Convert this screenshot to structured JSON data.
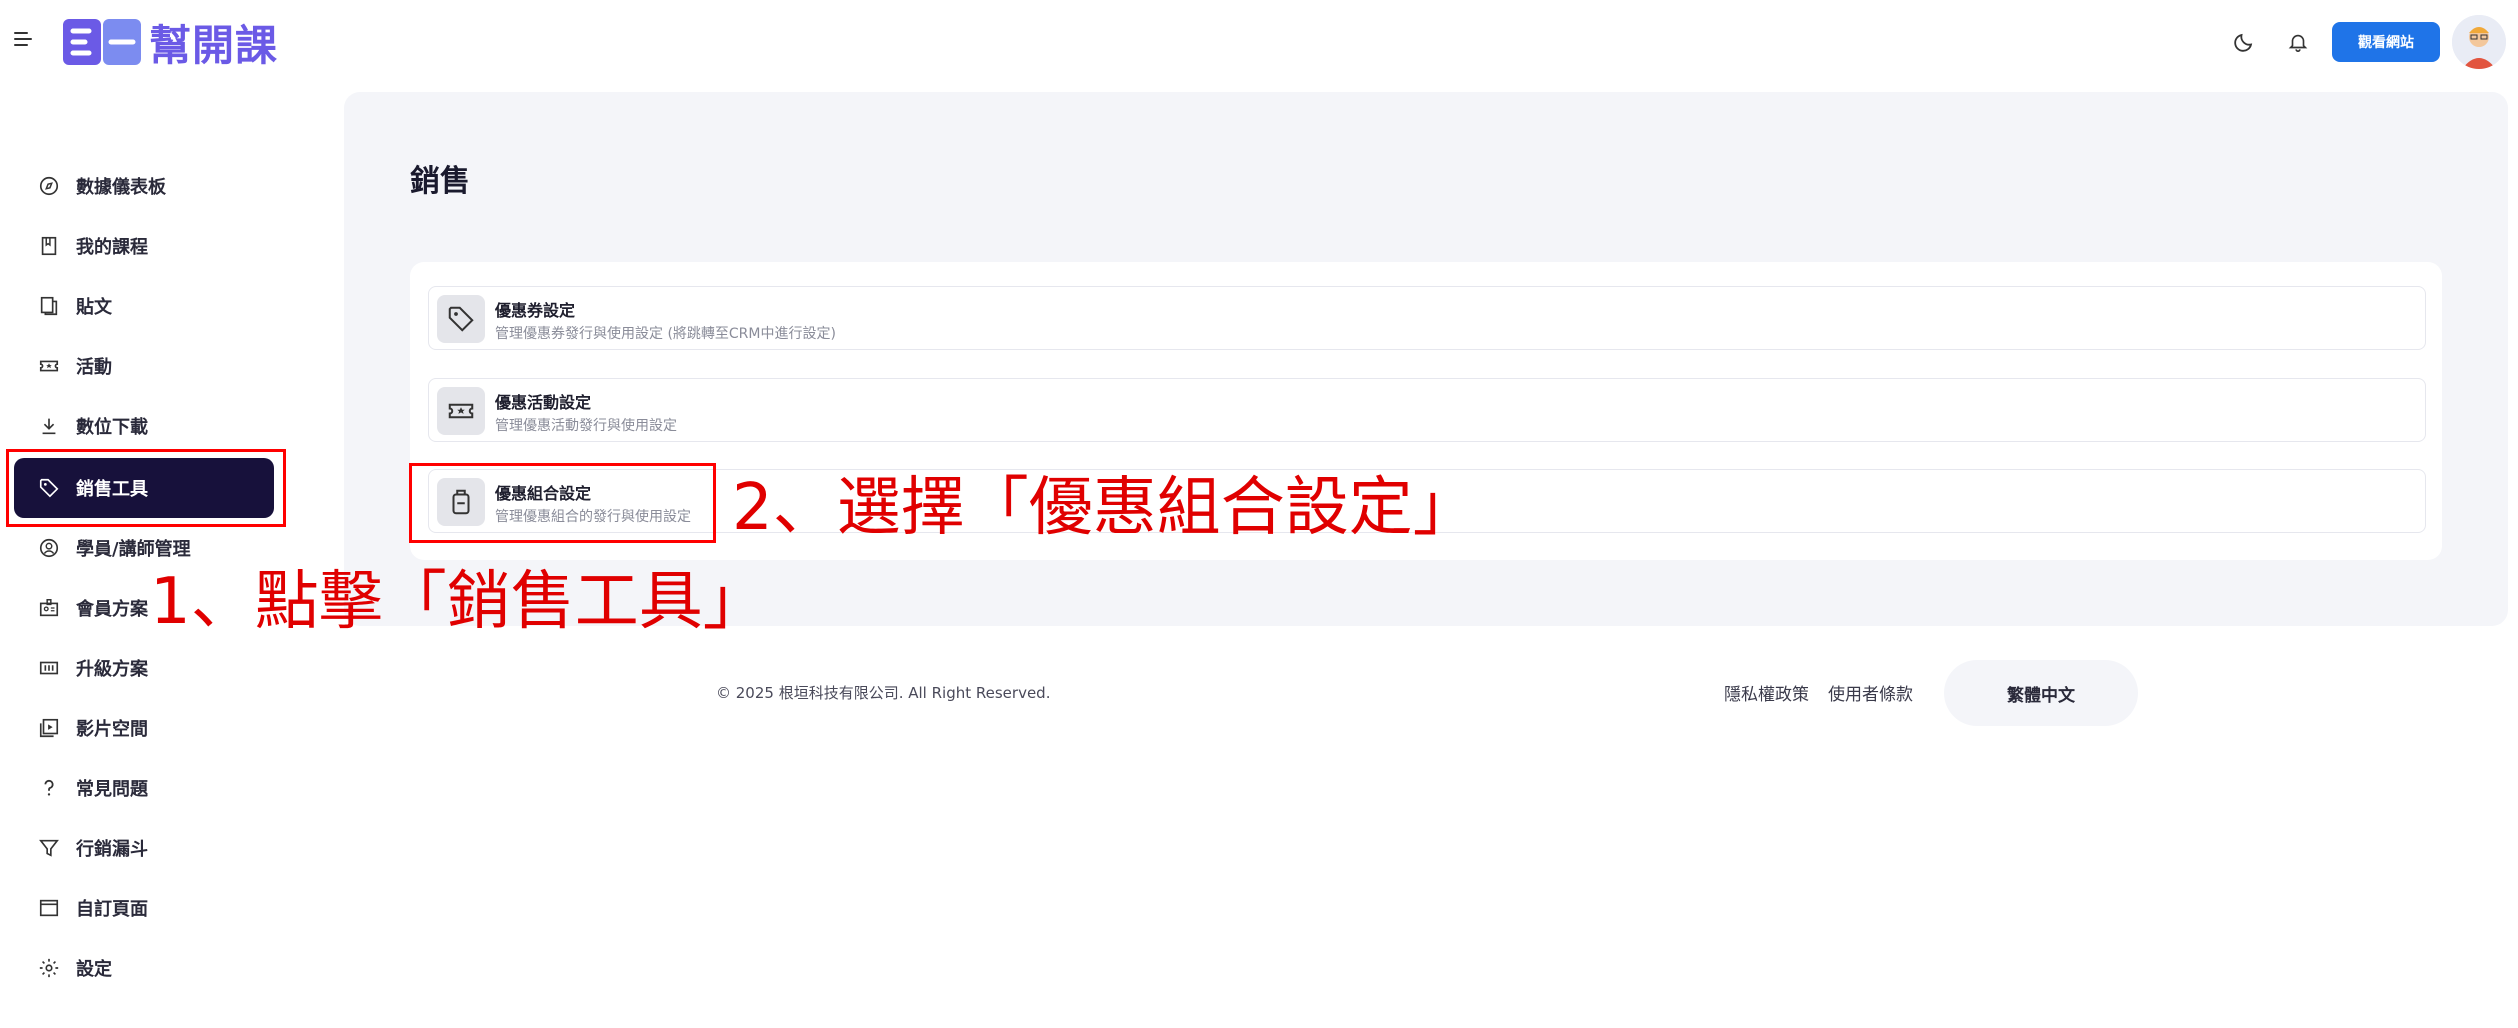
{
  "brand": {
    "logo_text": "幫開課",
    "logo_mark": "E一"
  },
  "header": {
    "view_site_label": "觀看網站"
  },
  "sidebar": {
    "items": [
      {
        "label": "數據儀表板",
        "icon": "compass-icon"
      },
      {
        "label": "我的課程",
        "icon": "book-icon"
      },
      {
        "label": "貼文",
        "icon": "post-icon"
      },
      {
        "label": "活動",
        "icon": "ticket-icon"
      },
      {
        "label": "數位下載",
        "icon": "download-icon"
      },
      {
        "label": "銷售工具",
        "icon": "tag-icon",
        "active": true
      },
      {
        "label": "學員/講師管理",
        "icon": "user-circle-icon"
      },
      {
        "label": "會員方案",
        "icon": "id-badge-icon"
      },
      {
        "label": "升級方案",
        "icon": "upgrade-icon"
      },
      {
        "label": "影片空間",
        "icon": "video-icon"
      },
      {
        "label": "常見問題",
        "icon": "question-icon"
      },
      {
        "label": "行銷漏斗",
        "icon": "funnel-icon"
      },
      {
        "label": "自訂頁面",
        "icon": "page-icon"
      },
      {
        "label": "設定",
        "icon": "gear-icon"
      }
    ]
  },
  "main": {
    "title": "銷售",
    "rows": [
      {
        "title": "優惠券設定",
        "desc": "管理優惠券發行與使用設定 (將跳轉至CRM中進行設定)",
        "icon": "tag-icon"
      },
      {
        "title": "優惠活動設定",
        "desc": "管理優惠活動發行與使用設定",
        "icon": "ticket-icon"
      },
      {
        "title": "優惠組合設定",
        "desc": "管理優惠組合的發行與使用設定",
        "icon": "bundle-icon"
      }
    ]
  },
  "annotations": {
    "step1": "1、點擊「銷售工具」",
    "step2": "2、選擇「優惠組合設定」",
    "color": "#e00000"
  },
  "footer": {
    "copyright": "© 2025 根垣科技有限公司. All Right Reserved.",
    "privacy": "隱私權政策",
    "terms": "使用者條款",
    "language": "繁體中文"
  },
  "colors": {
    "accent": "#1f74e8",
    "active_nav": "#17113b",
    "brand": "#6b5ae6"
  }
}
